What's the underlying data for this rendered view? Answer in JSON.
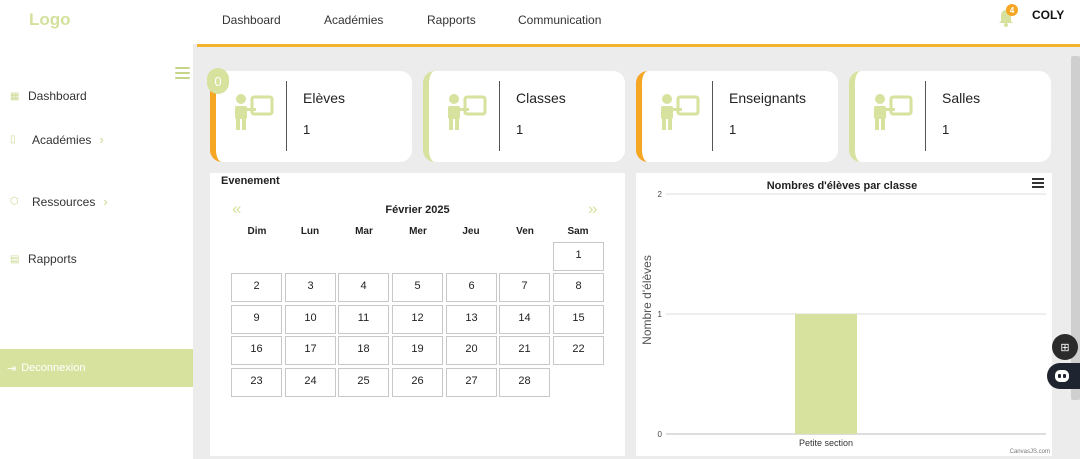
{
  "sidebar": {
    "logo": "Logo",
    "items": [
      {
        "label": "Dashboard",
        "icon": "grid-icon"
      },
      {
        "label": "Académies",
        "icon": "book-icon"
      },
      {
        "label": "Ressources",
        "icon": "box-icon"
      },
      {
        "label": "Rapports",
        "icon": "file-icon"
      }
    ],
    "logout_label": "Deconnexion"
  },
  "topnav": {
    "links": [
      "Dashboard",
      "Académies",
      "Rapports",
      "Communication"
    ],
    "notification_count": "4",
    "username": "COLY"
  },
  "stats": {
    "zero_badge": "0",
    "cards": [
      {
        "title": "Elèves",
        "value": "1",
        "accent": "#f5a623"
      },
      {
        "title": "Classes",
        "value": "1",
        "accent": "#d6e29e"
      },
      {
        "title": "Enseignants",
        "value": "1",
        "accent": "#f5a623"
      },
      {
        "title": "Salles",
        "value": "1",
        "accent": "#d6e29e"
      }
    ]
  },
  "calendar": {
    "title": "Evenement",
    "month": "Février 2025",
    "prev": "«",
    "next": "»",
    "weekdays": [
      "Dim",
      "Lun",
      "Mar",
      "Mer",
      "Jeu",
      "Ven",
      "Sam"
    ],
    "days": [
      "1",
      "2",
      "3",
      "4",
      "5",
      "6",
      "7",
      "8",
      "9",
      "10",
      "11",
      "12",
      "13",
      "14",
      "15",
      "16",
      "17",
      "18",
      "19",
      "20",
      "21",
      "22",
      "23",
      "24",
      "25",
      "26",
      "27",
      "28"
    ]
  },
  "chart_data": {
    "type": "bar",
    "title": "Nombres d'élèves par classe",
    "categories": [
      "Petite section"
    ],
    "values": [
      1
    ],
    "xlabel": "",
    "ylabel": "Nombre d'élèves",
    "ylim": [
      0,
      2
    ],
    "yticks": [
      "0",
      "1",
      "2"
    ],
    "grid": true,
    "bar_color": "#d6e29e",
    "credit": "CanvasJS.com"
  },
  "colors": {
    "accent_orange": "#f5a623",
    "accent_green": "#d6e29e",
    "background": "#ececec"
  }
}
